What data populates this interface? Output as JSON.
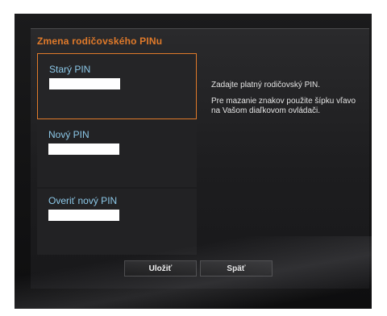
{
  "dialog": {
    "title": "Zmena rodičovského PINu",
    "fields": [
      {
        "label": "Starý PIN",
        "value": ""
      },
      {
        "label": "Nový PIN",
        "value": ""
      },
      {
        "label": "Overiť nový PIN",
        "value": ""
      }
    ],
    "info": {
      "line1": "Zadajte platný rodičovský PIN.",
      "line2": "Pre mazanie znakov použite šípku vľavo na Vašom diaľkovom ovládači."
    },
    "buttons": {
      "save": "Uložiť",
      "back": "Späť"
    },
    "colors": {
      "accent": "#e07a2a",
      "label": "#8cc8e8"
    }
  }
}
